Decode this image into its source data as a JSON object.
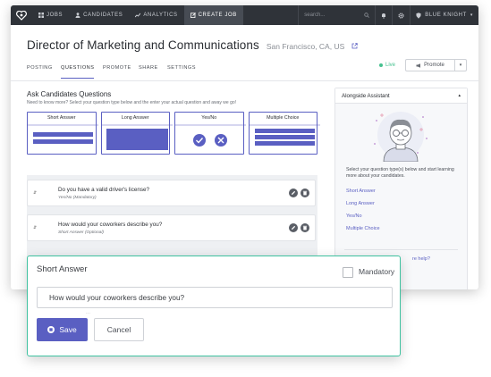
{
  "topbar": {
    "nav": [
      {
        "label": "JOBS",
        "icon": "grid-icon"
      },
      {
        "label": "CANDIDATES",
        "icon": "person-icon"
      },
      {
        "label": "ANALYTICS",
        "icon": "chart-icon"
      },
      {
        "label": "CREATE JOB",
        "icon": "edit-icon"
      }
    ],
    "search_placeholder": "search...",
    "user_name": "BLUE KNIGHT"
  },
  "job": {
    "title": "Director of Marketing and Communications",
    "location": "San Francisco, CA, US"
  },
  "tabs": [
    "POSTING",
    "QUESTIONS",
    "PROMOTE",
    "SHARE",
    "SETTINGS"
  ],
  "status": {
    "live_label": "Live",
    "promote_label": "Promote"
  },
  "questions_section": {
    "title": "Ask Candidates Questions",
    "subtitle": "Need to know more? Select your question type below and the enter your actual question and away we go!",
    "types": [
      "Short Answer",
      "Long Answer",
      "Yes/No",
      "Multiple Choice"
    ]
  },
  "questions": [
    {
      "text": "Do you have a valid driver's license?",
      "meta": "Yes/No (Mandatory)"
    },
    {
      "text": "How would your coworkers describe you?",
      "meta": "Short Answer (Optional)"
    }
  ],
  "assistant": {
    "title": "Alongside Assistant",
    "intro": "Select your question type(s) below and start learning more about your candidates.",
    "links": [
      "Short Answer",
      "Long Answer",
      "Yes/No",
      "Multiple Choice"
    ],
    "help_fragment": "re help?"
  },
  "modal": {
    "title": "Short Answer",
    "mandatory_label": "Mandatory",
    "question_value": "How would your coworkers describe you?",
    "save_label": "Save",
    "cancel_label": "Cancel"
  },
  "colors": {
    "accent": "#5a5fc2",
    "live": "#45c18f",
    "modal_border": "#3fc2a0",
    "topbar": "#2f3339"
  }
}
